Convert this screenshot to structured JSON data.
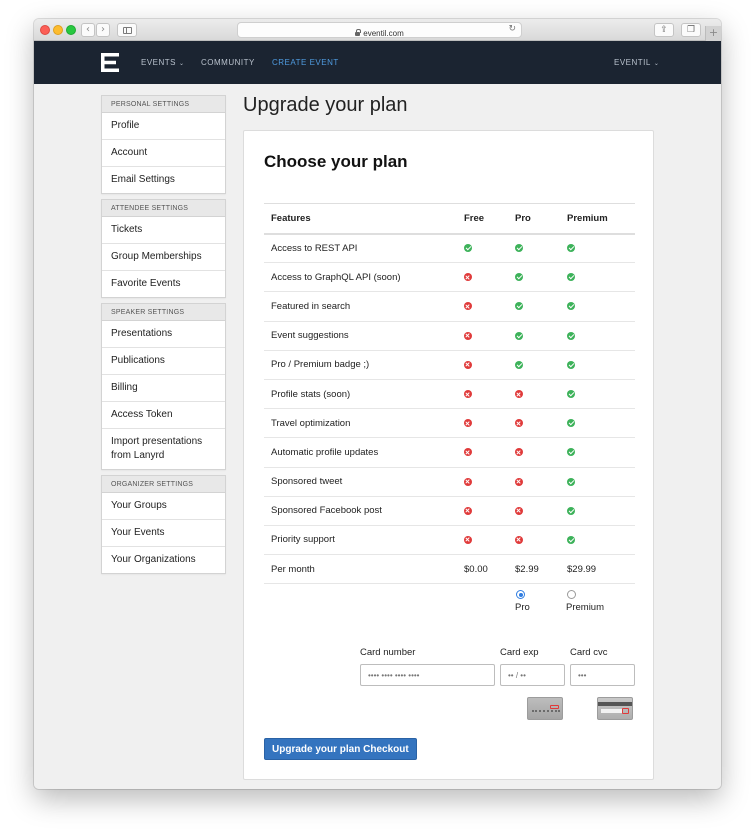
{
  "browser": {
    "url": "eventil.com",
    "back_icon": "‹",
    "forward_icon": "›",
    "reload_icon": "↻",
    "share_icon": "⇪",
    "tabs_icon": "❐",
    "new_tab_icon": "+"
  },
  "navbar": {
    "logo": "eventil-logo",
    "links": {
      "events": "EVENTS",
      "community": "COMMUNITY",
      "create_event": "CREATE EVENT",
      "user": "EVENTIL"
    },
    "caret": "⌄",
    "colors": {
      "background": "#1b2431",
      "active": "#4f9be0"
    }
  },
  "sidebar": {
    "groups": [
      {
        "header": "PERSONAL SETTINGS",
        "items": [
          "Profile",
          "Account",
          "Email Settings"
        ]
      },
      {
        "header": "ATTENDEE SETTINGS",
        "items": [
          "Tickets",
          "Group Memberships",
          "Favorite Events"
        ]
      },
      {
        "header": "SPEAKER SETTINGS",
        "items": [
          "Presentations",
          "Publications",
          "Billing",
          "Access Token",
          "Import presentations from Lanyrd"
        ]
      },
      {
        "header": "ORGANIZER SETTINGS",
        "items": [
          "Your Groups",
          "Your Events",
          "Your Organizations"
        ]
      }
    ]
  },
  "main": {
    "page_title": "Upgrade your plan",
    "card_title": "Choose your plan",
    "table": {
      "headers": [
        "Features",
        "Free",
        "Pro",
        "Premium"
      ],
      "rows": [
        {
          "feature": "Access to REST API",
          "free": true,
          "pro": true,
          "premium": true
        },
        {
          "feature": "Access to GraphQL API (soon)",
          "free": false,
          "pro": true,
          "premium": true
        },
        {
          "feature": "Featured in search",
          "free": false,
          "pro": true,
          "premium": true
        },
        {
          "feature": "Event suggestions",
          "free": false,
          "pro": true,
          "premium": true
        },
        {
          "feature": "Pro / Premium badge ;)",
          "free": false,
          "pro": true,
          "premium": true
        },
        {
          "feature": "Profile stats (soon)",
          "free": false,
          "pro": false,
          "premium": true
        },
        {
          "feature": "Travel optimization",
          "free": false,
          "pro": false,
          "premium": true
        },
        {
          "feature": "Automatic profile updates",
          "free": false,
          "pro": false,
          "premium": true
        },
        {
          "feature": "Sponsored tweet",
          "free": false,
          "pro": false,
          "premium": true
        },
        {
          "feature": "Sponsored Facebook post",
          "free": false,
          "pro": false,
          "premium": true
        },
        {
          "feature": "Priority support",
          "free": false,
          "pro": false,
          "premium": true
        }
      ],
      "price_row": {
        "label": "Per month",
        "free": "$0.00",
        "pro": "$2.99",
        "premium": "$29.99"
      }
    },
    "plan_options": {
      "pro": {
        "label": "Pro",
        "selected": true
      },
      "premium": {
        "label": "Premium",
        "selected": false
      }
    },
    "payment": {
      "card_number": {
        "label": "Card number",
        "placeholder": "•••• •••• •••• ••••"
      },
      "card_exp": {
        "label": "Card exp",
        "placeholder": "•• / ••"
      },
      "card_cvc": {
        "label": "Card cvc",
        "placeholder": "•••"
      },
      "card_front_icon": "credit-card-front-icon",
      "card_back_icon": "credit-card-back-icon"
    },
    "checkout_button": "Upgrade your plan Checkout",
    "colors": {
      "check": "#3db25a",
      "cross": "#e03a3a",
      "button": "#3474bf"
    }
  }
}
